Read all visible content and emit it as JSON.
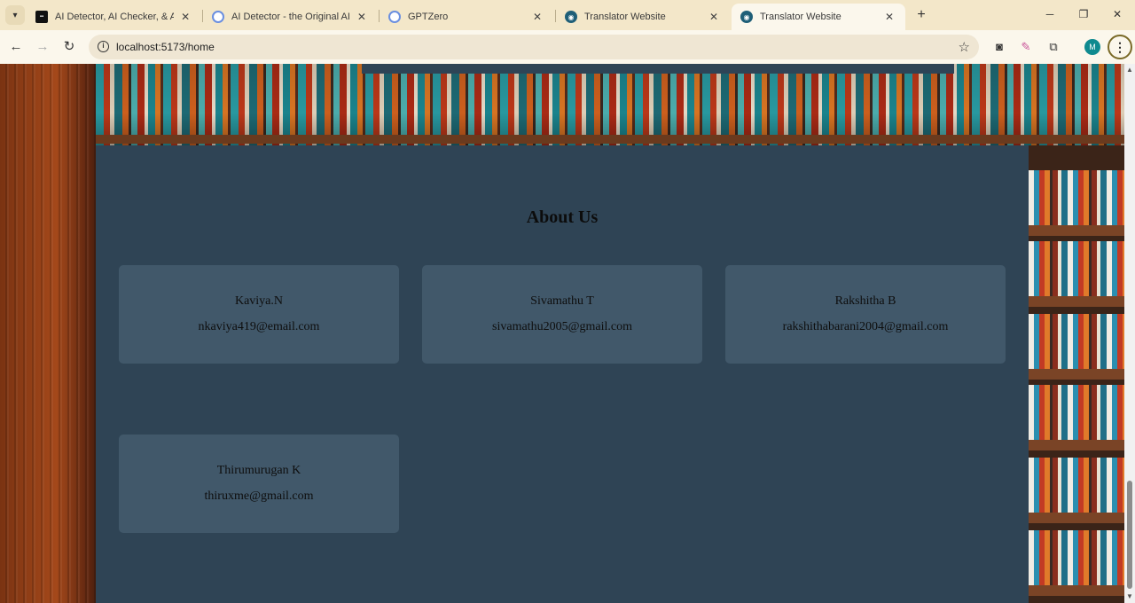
{
  "browser": {
    "tabs": [
      {
        "title": "AI Detector, AI Checker, & AI Hu",
        "favicon": "site-logo-icon",
        "active": false
      },
      {
        "title": "AI Detector - the Original AI Ch",
        "favicon": "gptzero-icon",
        "active": false
      },
      {
        "title": "GPTZero",
        "favicon": "gptzero-icon",
        "active": false
      },
      {
        "title": "Translator Website",
        "favicon": "translator-icon",
        "active": false
      },
      {
        "title": "Translator Website",
        "favicon": "translator-icon",
        "active": true
      }
    ],
    "url": "localhost:5173/home",
    "profile_initial": "M"
  },
  "about": {
    "heading": "About Us",
    "members": [
      {
        "name": "Kaviya.N",
        "email": "nkaviya419@email.com"
      },
      {
        "name": "Sivamathu T",
        "email": "sivamathu2005@gmail.com"
      },
      {
        "name": "Rakshitha B",
        "email": "rakshithabarani2004@gmail.com"
      },
      {
        "name": "Thirumurugan K",
        "email": "thiruxme@gmail.com"
      }
    ]
  },
  "colors": {
    "panel": "#2f4455",
    "card": "#41586a",
    "chrome": "#f3e7c9"
  }
}
